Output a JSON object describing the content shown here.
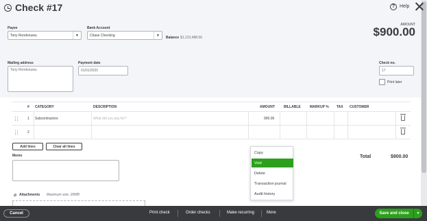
{
  "header": {
    "title": "Check #17",
    "help_label": "Help",
    "history_icon": "history-icon",
    "close_icon": "close-icon"
  },
  "form": {
    "payee_label": "Payee",
    "payee_value": "Tony Rondonuwu",
    "bank_label": "Bank Account",
    "bank_value": "Chase Checking",
    "balance_label": "Balance",
    "balance_value": "$1,123,488.56",
    "amount_label": "AMOUNT",
    "amount_value": "$900.00",
    "mailing_label": "Mailing address",
    "mailing_value": "Tony Rondonuwu",
    "date_label": "Payment date",
    "date_value": "01/01/2020",
    "checkno_label": "Check no.",
    "checkno_value": "17",
    "print_later_label": "Print later"
  },
  "table": {
    "headers": {
      "num": "#",
      "category": "CATEGORY",
      "description": "DESCRIPTION",
      "amount": "AMOUNT",
      "billable": "BILLABLE",
      "markup": "MARKUP %",
      "tax": "TAX",
      "customer": "CUSTOMER"
    },
    "rows": [
      {
        "num": "1",
        "category": "Subcontractors",
        "description": "What did you pay for?",
        "amount": "900.00"
      },
      {
        "num": "2",
        "category": "",
        "description": "",
        "amount": ""
      }
    ],
    "add_lines": "Add lines",
    "clear_lines": "Clear all lines"
  },
  "memo_label": "Memo",
  "attachments": {
    "label": "Attachments",
    "max_size": "Maximum size: 20MB"
  },
  "total": {
    "label": "Total",
    "value": "$900.00"
  },
  "more_menu": {
    "items": [
      "Copy",
      "Void",
      "Delete",
      "Transaction journal",
      "Audit history"
    ],
    "selected": "Void"
  },
  "footer": {
    "cancel": "Cancel",
    "print_check": "Print check",
    "order_checks": "Order checks",
    "make_recurring": "Make recurring",
    "more": "More",
    "save_close": "Save and close"
  },
  "colors": {
    "accent_green": "#2ca01c",
    "footer_bg": "#393a3d",
    "band_bg": "#f4f5f8"
  }
}
